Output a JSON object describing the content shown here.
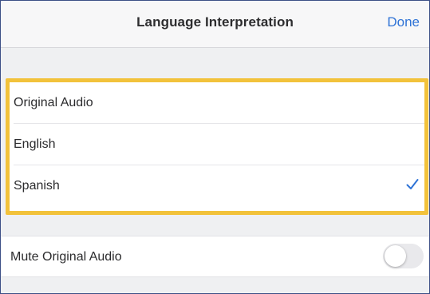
{
  "header": {
    "title": "Language Interpretation",
    "done_label": "Done"
  },
  "language_options": [
    {
      "label": "Original Audio",
      "selected": false
    },
    {
      "label": "English",
      "selected": false
    },
    {
      "label": "Spanish",
      "selected": true
    }
  ],
  "mute_original_audio": {
    "label": "Mute Original Audio",
    "enabled": false
  },
  "colors": {
    "accent": "#2f73d6",
    "highlight_border": "#f2c23b",
    "background": "#eff0f2"
  },
  "icons": {
    "selected": "checkmark-icon"
  }
}
